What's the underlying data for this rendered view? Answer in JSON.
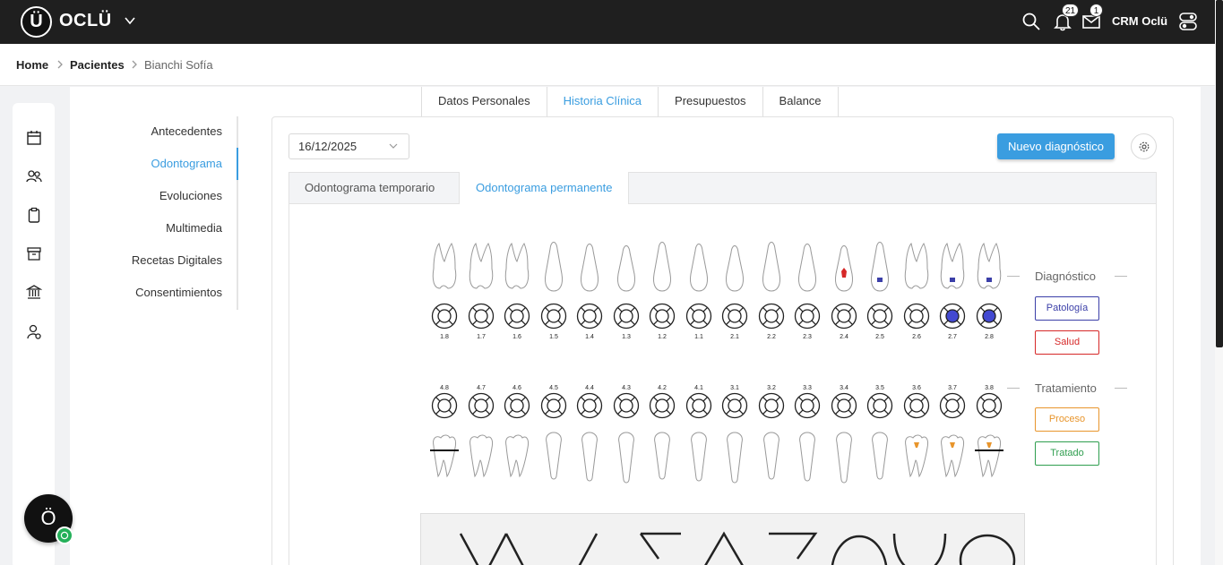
{
  "brand": {
    "logo_letter": "Ü",
    "name": "OCLÜ"
  },
  "header": {
    "notifications_count": "21",
    "messages_count": "1",
    "crm_label": "CRM Oclü"
  },
  "breadcrumb": {
    "home": "Home",
    "section": "Pacientes",
    "current": "Bianchi Sofía"
  },
  "rail_icons": [
    "calendar-icon",
    "users-icon",
    "clipboard-icon",
    "archive-icon",
    "bank-icon",
    "user-settings-icon"
  ],
  "patient_tabs": [
    "Datos Personales",
    "Historia Clínica",
    "Presupuestos",
    "Balance"
  ],
  "patient_tab_active": "Historia Clínica",
  "side_nav": [
    "Antecedentes",
    "Odontograma",
    "Evoluciones",
    "Multimedia",
    "Recetas Digitales",
    "Consentimientos"
  ],
  "side_nav_active": "Odontograma",
  "date_value": "16/12/2025",
  "new_diagnosis_label": "Nuevo diagnóstico",
  "odonto_tabs": [
    "Odontograma temporario",
    "Odontograma permanente"
  ],
  "odonto_tab_active": "Odontograma permanente",
  "upper_teeth": [
    "1.8",
    "1.7",
    "1.6",
    "1.5",
    "1.4",
    "1.3",
    "1.2",
    "1.1",
    "2.1",
    "2.2",
    "2.3",
    "2.4",
    "2.5",
    "2.6",
    "2.7",
    "2.8"
  ],
  "lower_teeth": [
    "4.8",
    "4.7",
    "4.6",
    "4.5",
    "4.4",
    "4.3",
    "4.2",
    "4.1",
    "3.1",
    "3.2",
    "3.3",
    "3.4",
    "3.5",
    "3.6",
    "3.7",
    "3.8"
  ],
  "upper_filled": [
    "2.7",
    "2.8"
  ],
  "legend": {
    "diagnostico": "Diagnóstico",
    "patologia": "Patología",
    "salud": "Salud",
    "tratamiento": "Tratamiento",
    "proceso": "Proceso",
    "tratado": "Tratado"
  },
  "colors": {
    "accent": "#3a9de0",
    "patologia": "#3b3fa8",
    "salud": "#d62828",
    "proceso": "#e8952c",
    "tratado": "#2f9e4f",
    "filled": "#4349d1"
  },
  "floating_button_letter": "Ö"
}
